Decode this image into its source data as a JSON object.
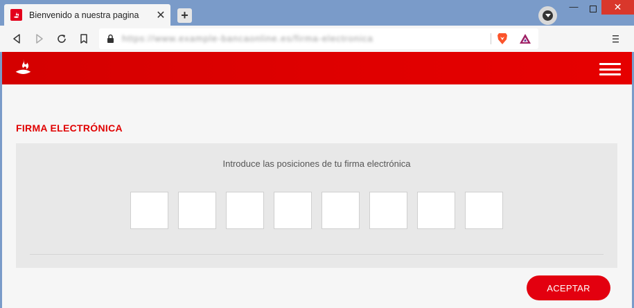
{
  "browser": {
    "tab_title": "Bienvenido a nuestra pagina",
    "close_glyph": "✕",
    "new_tab_glyph": "+",
    "url": "https://www.example-bancaonline.es/firma-electronica",
    "window_min_glyph": "—",
    "window_close_glyph": "✕"
  },
  "site": {
    "brand_color": "#e00000",
    "section_title": "FIRMA ELECTRÓNICA",
    "instruction": "Introduce las posiciones de tu firma electrónica",
    "positions_count": 8,
    "accept_label": "ACEPTAR"
  },
  "icons": [
    "santander-flame-icon",
    "back-icon",
    "forward-icon",
    "reload-icon",
    "bookmark-icon",
    "lock-icon",
    "brave-lion-icon",
    "brave-rewards-icon",
    "menu-icon",
    "hamburger-icon",
    "dropdown-icon"
  ]
}
